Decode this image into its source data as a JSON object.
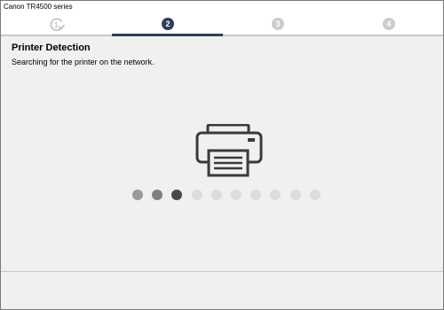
{
  "window": {
    "title": "Canon TR4500 series"
  },
  "steps": [
    {
      "number": "1",
      "state": "done",
      "icon": "step-complete-icon"
    },
    {
      "number": "2",
      "state": "active"
    },
    {
      "number": "3",
      "state": "pending"
    },
    {
      "number": "4",
      "state": "pending"
    }
  ],
  "content": {
    "title": "Printer Detection",
    "description": "Searching for the printer on the network."
  },
  "status_icon": "printer-icon",
  "progress": {
    "total_dots": 10,
    "filled_dots": 3,
    "colors": {
      "filled_light": "#9a9a9a",
      "filled_mid": "#7f7f7f",
      "filled_current": "#4a4a4a",
      "empty": "#dcdcdc"
    }
  },
  "colors": {
    "accent": "#2c3e5c",
    "inactive_step": "#cccccc",
    "window_bg": "#f0f0f0"
  }
}
